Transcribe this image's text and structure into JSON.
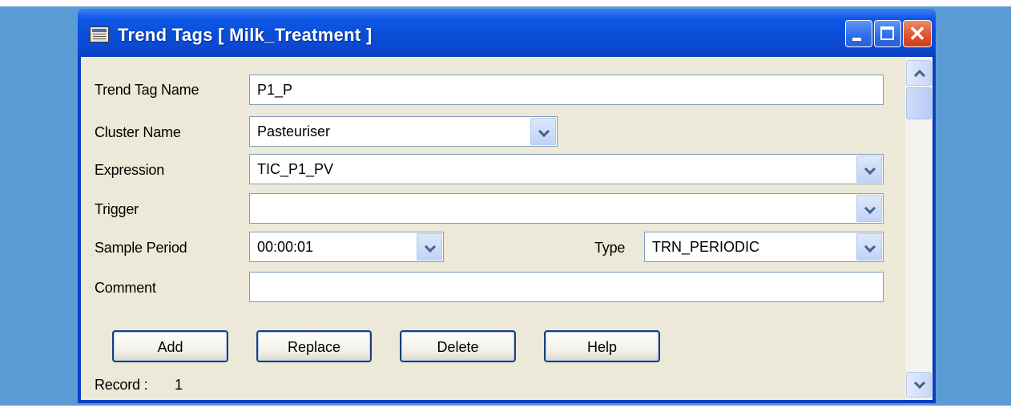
{
  "window": {
    "title": "Trend Tags [ Milk_Treatment ]",
    "close_glyph": "✕"
  },
  "form": {
    "trend_tag_name": {
      "label": "Trend Tag Name",
      "value": "P1_P"
    },
    "cluster_name": {
      "label": "Cluster Name",
      "value": "Pasteuriser"
    },
    "expression": {
      "label": "Expression",
      "value": "TIC_P1_PV"
    },
    "trigger": {
      "label": "Trigger",
      "value": ""
    },
    "sample_period": {
      "label": "Sample Period",
      "value": "00:00:01"
    },
    "type": {
      "label": "Type",
      "value": "TRN_PERIODIC"
    },
    "comment": {
      "label": "Comment",
      "value": ""
    }
  },
  "buttons": {
    "add": "Add",
    "replace": "Replace",
    "delete": "Delete",
    "help": "Help"
  },
  "status": {
    "record_label": "Record :",
    "record_value": "1"
  },
  "icons": {
    "title": "form-window-icon",
    "dropdown": "chevron-down-icon",
    "scroll_up": "chevron-up-icon",
    "scroll_down": "chevron-down-icon"
  },
  "colors": {
    "titlebar": "#0a4ed8",
    "client_background": "#ece9d8",
    "close_button": "#e0532e",
    "desktop": "#5b9bd5"
  }
}
